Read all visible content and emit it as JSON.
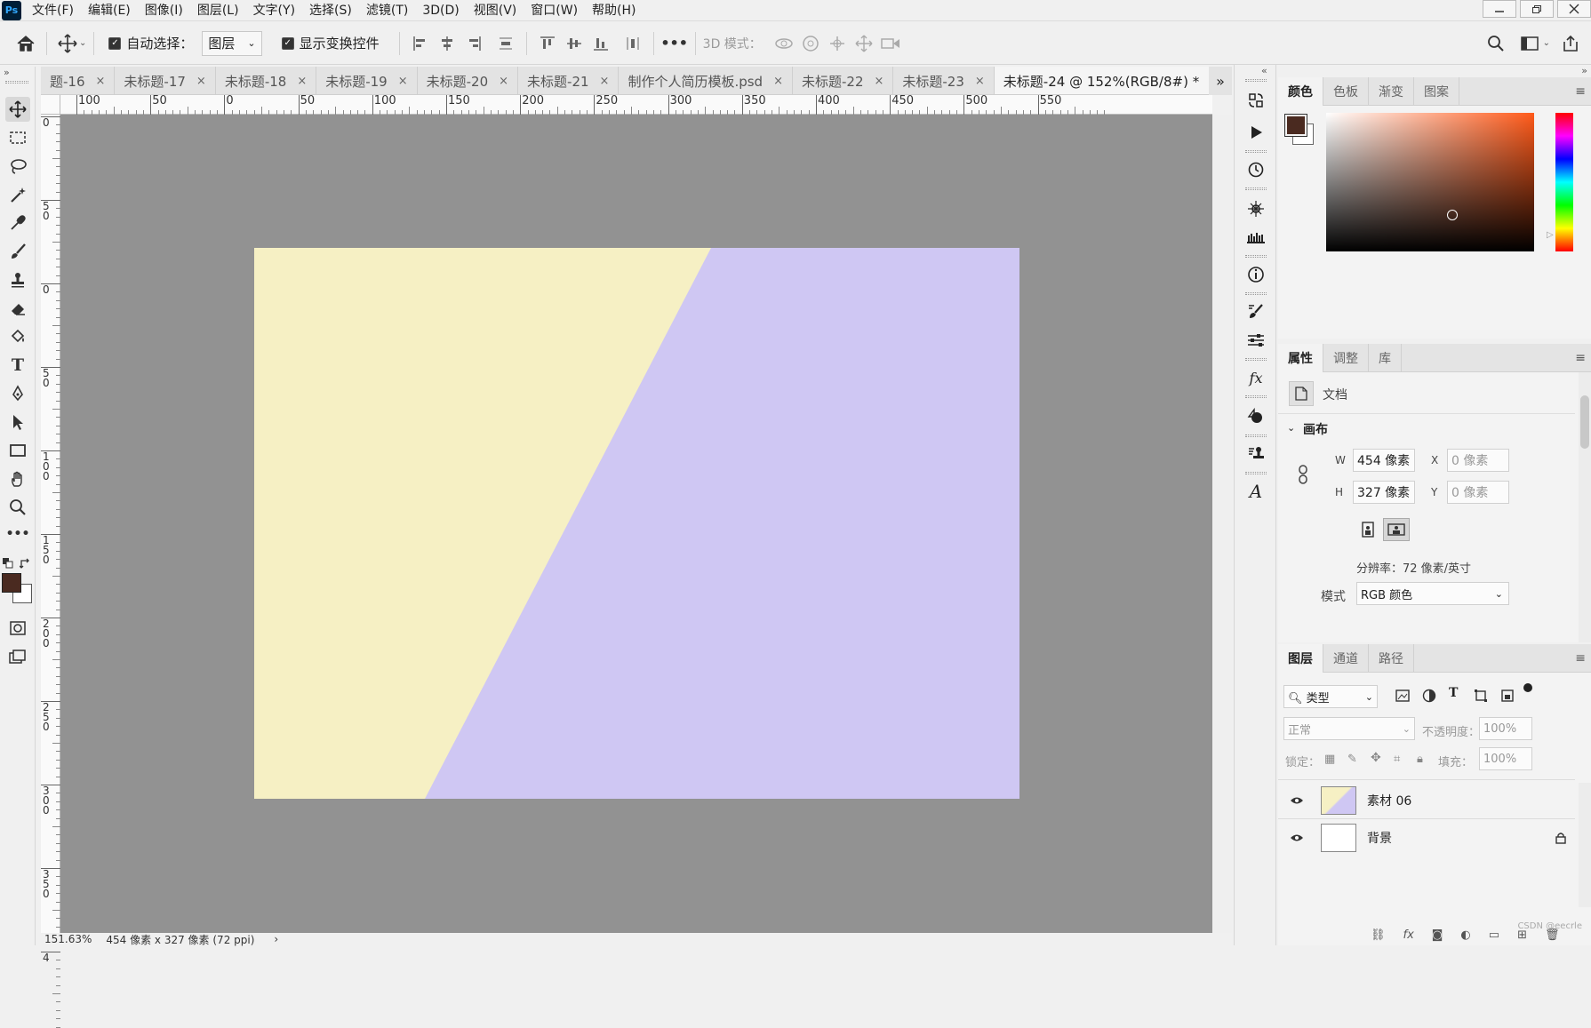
{
  "app": {
    "logo": "Ps"
  },
  "menu": [
    "文件(F)",
    "编辑(E)",
    "图像(I)",
    "图层(L)",
    "文字(Y)",
    "选择(S)",
    "滤镜(T)",
    "3D(D)",
    "视图(V)",
    "窗口(W)",
    "帮助(H)"
  ],
  "options": {
    "auto_select_label": "自动选择：",
    "auto_select_checked": true,
    "auto_select_target": "图层",
    "show_transform_label": "显示变换控件",
    "show_transform_checked": true,
    "mode_3d_label": "3D 模式：",
    "more": "•••"
  },
  "tabs": [
    {
      "label": "题-16",
      "active": false
    },
    {
      "label": "未标题-17",
      "active": false
    },
    {
      "label": "未标题-18",
      "active": false
    },
    {
      "label": "未标题-19",
      "active": false
    },
    {
      "label": "未标题-20",
      "active": false
    },
    {
      "label": "未标题-21",
      "active": false
    },
    {
      "label": "制作个人简历模板.psd",
      "active": false
    },
    {
      "label": "未标题-22",
      "active": false
    },
    {
      "label": "未标题-23",
      "active": false
    },
    {
      "label": "未标题-24 @ 152%(RGB/8#) *",
      "active": true
    }
  ],
  "tab_overflow": "»",
  "ruler": {
    "h_labels": [
      "100",
      "50",
      "0",
      "50",
      "100",
      "150",
      "200",
      "250",
      "300",
      "350",
      "400",
      "450",
      "500",
      "550"
    ],
    "v_labels": [
      "0",
      "50",
      "0",
      "50",
      "100",
      "150",
      "200",
      "250",
      "300",
      "350",
      "4"
    ]
  },
  "canvas": {
    "colors": {
      "workspace": "#929292",
      "yellow": "#f6f0c4",
      "purple": "#cfc7f3"
    }
  },
  "status": {
    "zoom": "151.63%",
    "doc_info": "454 像素 x 327 像素 (72 ppi)",
    "arrow": "›"
  },
  "color_panel": {
    "tabs": [
      "颜色",
      "色板",
      "渐变",
      "图案"
    ],
    "foreground": "#4a2a20",
    "background": "#ffffff",
    "hue_color": "#ff5a1a"
  },
  "properties": {
    "tabs": [
      "属性",
      "调整",
      "库"
    ],
    "doc_label": "文档",
    "section": "画布",
    "w_label": "W",
    "w_value": "454 像素",
    "h_label": "H",
    "h_value": "327 像素",
    "x_label": "X",
    "x_value": "0 像素",
    "y_label": "Y",
    "y_value": "0 像素",
    "resolution": "分辨率：72 像素/英寸",
    "mode_label": "模式",
    "mode_value": "RGB 颜色"
  },
  "layers_panel": {
    "tabs": [
      "图层",
      "通道",
      "路径"
    ],
    "filter_kind": "类型",
    "blend_mode": "正常",
    "opacity_label": "不透明度：",
    "opacity_value": "100%",
    "lock_label": "锁定：",
    "fill_label": "填充：",
    "fill_value": "100%",
    "layers": [
      {
        "name": "素材 06",
        "visible": true,
        "locked": false
      },
      {
        "name": "背景",
        "visible": true,
        "locked": true
      }
    ],
    "watermark": "CSDN @eecrle"
  }
}
